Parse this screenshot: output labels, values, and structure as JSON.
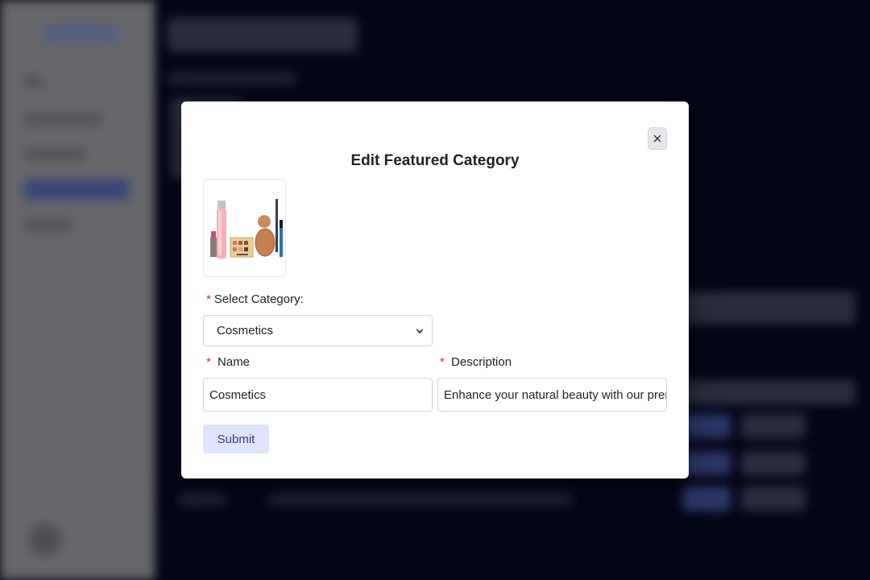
{
  "modal": {
    "title": "Edit Featured Category",
    "close_icon": "close-icon",
    "image_icon": "cosmetics-product-image",
    "select_label": "Select Category:",
    "select_value": "Cosmetics",
    "name_label": "Name",
    "name_value": "Cosmetics",
    "description_label": "Description",
    "description_value": "Enhance your natural beauty with our premiu",
    "required_mark": "*",
    "submit_label": "Submit"
  },
  "colors": {
    "overlay_bg": "#050a1f",
    "required": "#dc2626",
    "submit_bg": "#e0e4fb",
    "submit_text": "#2e3a8c"
  }
}
